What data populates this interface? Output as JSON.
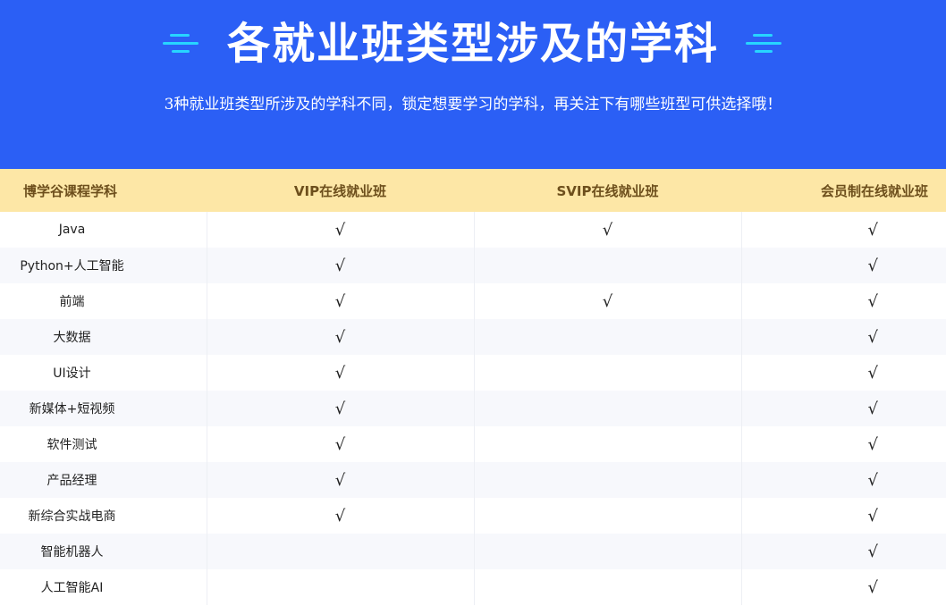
{
  "hero": {
    "title": "各就业班类型涉及的学科",
    "subtitle": "3种就业班类型所涉及的学科不同，锁定想要学习的学科，再关注下有哪些班型可供选择哦！",
    "background": "#2b5ff5",
    "decoration_color": "#27d5ff"
  },
  "table": {
    "headers": [
      "博学谷课程学科",
      "VIP在线就业班",
      "SVIP在线就业班",
      "会员制在线就业班"
    ],
    "header_background": "#fde7a6",
    "check_glyph": "√",
    "rows": [
      {
        "subject": "Java",
        "vip": true,
        "svip": true,
        "member": true
      },
      {
        "subject": "Python+人工智能",
        "vip": true,
        "svip": false,
        "member": true
      },
      {
        "subject": "前端",
        "vip": true,
        "svip": true,
        "member": true
      },
      {
        "subject": "大数据",
        "vip": true,
        "svip": false,
        "member": true
      },
      {
        "subject": "UI设计",
        "vip": true,
        "svip": false,
        "member": true
      },
      {
        "subject": "新媒体+短视频",
        "vip": true,
        "svip": false,
        "member": true
      },
      {
        "subject": "软件测试",
        "vip": true,
        "svip": false,
        "member": true
      },
      {
        "subject": "产品经理",
        "vip": true,
        "svip": false,
        "member": true
      },
      {
        "subject": "新综合实战电商",
        "vip": true,
        "svip": false,
        "member": true
      },
      {
        "subject": "智能机器人",
        "vip": false,
        "svip": false,
        "member": true
      },
      {
        "subject": "人工智能AI",
        "vip": false,
        "svip": false,
        "member": true
      }
    ]
  }
}
